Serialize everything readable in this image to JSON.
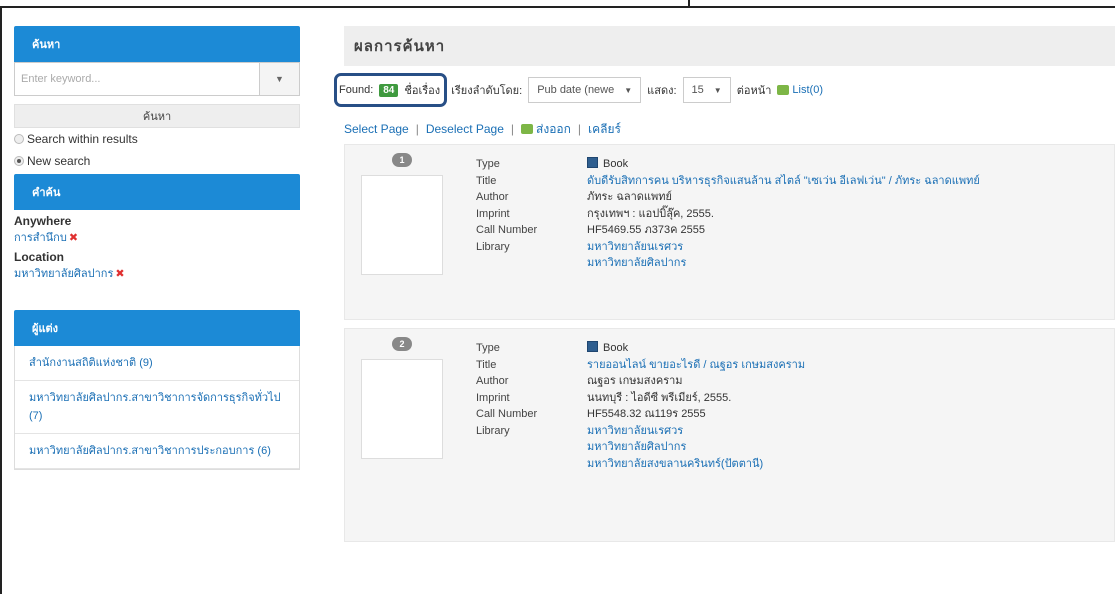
{
  "sidebar": {
    "search_title": "ค้นหา",
    "search_placeholder": "Enter keyword...",
    "search_button": "ค้นหา",
    "radio_within": "Search within results",
    "radio_new": "New search",
    "terms_title": "คำค้น",
    "facets": [
      {
        "label": "Anywhere",
        "value": "การสำนึกบ"
      },
      {
        "label": "Location",
        "value": "มหาวิทยาลัยศิลปากร"
      }
    ],
    "author_title": "ผู้แต่ง",
    "authors": [
      "สำนักงานสถิติแห่งชาติ (9)",
      "มหาวิทยาลัยศิลปากร.สาขาวิชาการจัดการธุรกิจทั่วไป (7)",
      "มหาวิทยาลัยศิลปากร.สาขาวิชาการประกอบการ (6)"
    ]
  },
  "main": {
    "heading": "ผลการค้นหา",
    "found_label": "Found:",
    "found_count": "84",
    "found_unit": "ชื่อเรื่อง",
    "sort_label": "เรียงลำดับโดย:",
    "sort_value": "Pub date (newe",
    "show_label": "แสดง:",
    "show_value": "15",
    "per_page_label": "ต่อหน้า",
    "list_label": "List(0)",
    "actions": {
      "select_page": "Select Page",
      "deselect_page": "Deselect Page",
      "export": "ส่งออก",
      "clear": "เคลียร์"
    },
    "results": [
      {
        "num": "1",
        "type": "Book",
        "title": "ดับดีรับสิทการคน บริหารธุรกิจแสนล้าน สไตล์ \"เซเว่น อีเลฟเว่น\" / ภัทระ ฉลาดแพทย์",
        "author": "ภัทระ ฉลาดแพทย์",
        "imprint": "กรุงเทพฯ : แอปบิ๊ลุ๊ค, 2555.",
        "call_number": "HF5469.55 ภ373ค 2555",
        "library": [
          "มหาวิทยาลัยนเรศวร",
          "มหาวิทยาลัยศิลปากร"
        ]
      },
      {
        "num": "2",
        "type": "Book",
        "title": "รายออนไลน์ ขายอะไรดี / ณฐอร เกษมสงคราม",
        "author": "ณฐอร เกษมสงคราม",
        "imprint": "นนทบุรี : ไอดีซี พรีเมียร์, 2555.",
        "call_number": "HF5548.32 ณ119ร 2555",
        "library": [
          "มหาวิทยาลัยนเรศวร",
          "มหาวิทยาลัยศิลปากร",
          "มหาวิทยาลัยสงขลานครินทร์(ปัตตานี)"
        ]
      }
    ],
    "field_labels": {
      "type": "Type",
      "title": "Title",
      "author": "Author",
      "imprint": "Imprint",
      "call_number": "Call Number",
      "library": "Library"
    }
  }
}
